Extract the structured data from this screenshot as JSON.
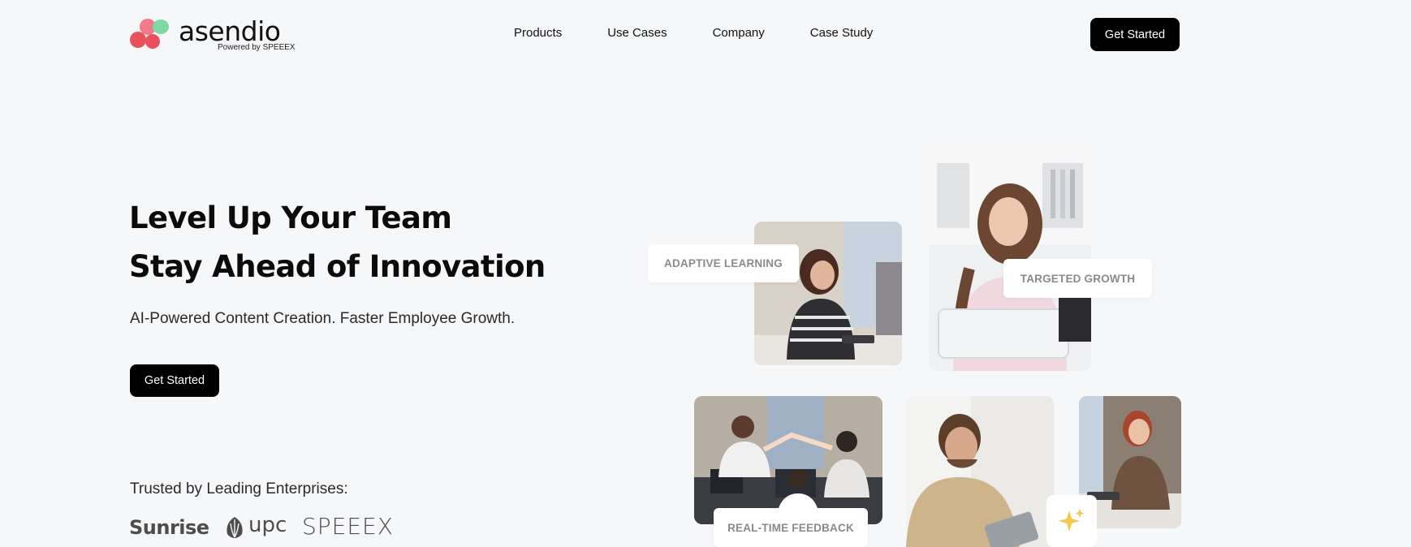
{
  "header": {
    "logo_word": "asendio",
    "logo_sub": "Powered by SPEEEX",
    "nav": [
      "Products",
      "Use Cases",
      "Company",
      "Case Study"
    ],
    "cta_label": "Get Started"
  },
  "hero": {
    "title_line1": "Level Up Your Team",
    "title_line2": "Stay Ahead of Innovation",
    "subtitle": "AI-Powered Content Creation. Faster Employee Growth.",
    "cta_label": "Get Started"
  },
  "trusted": {
    "label": "Trusted by Leading Enterprises:",
    "brands": [
      "Sunrise",
      "upc",
      "SPEEEX"
    ]
  },
  "visual": {
    "pills": {
      "adaptive": "ADAPTIVE LEARNING",
      "targeted": "TARGETED GROWTH",
      "realtime": "REAL-TIME FEEDBACK"
    },
    "accent_colors": {
      "logo_red": "#e8505b",
      "logo_pink": "#f07a87",
      "logo_green": "#7ed9a4",
      "sparkle": "#f2c94c"
    }
  }
}
